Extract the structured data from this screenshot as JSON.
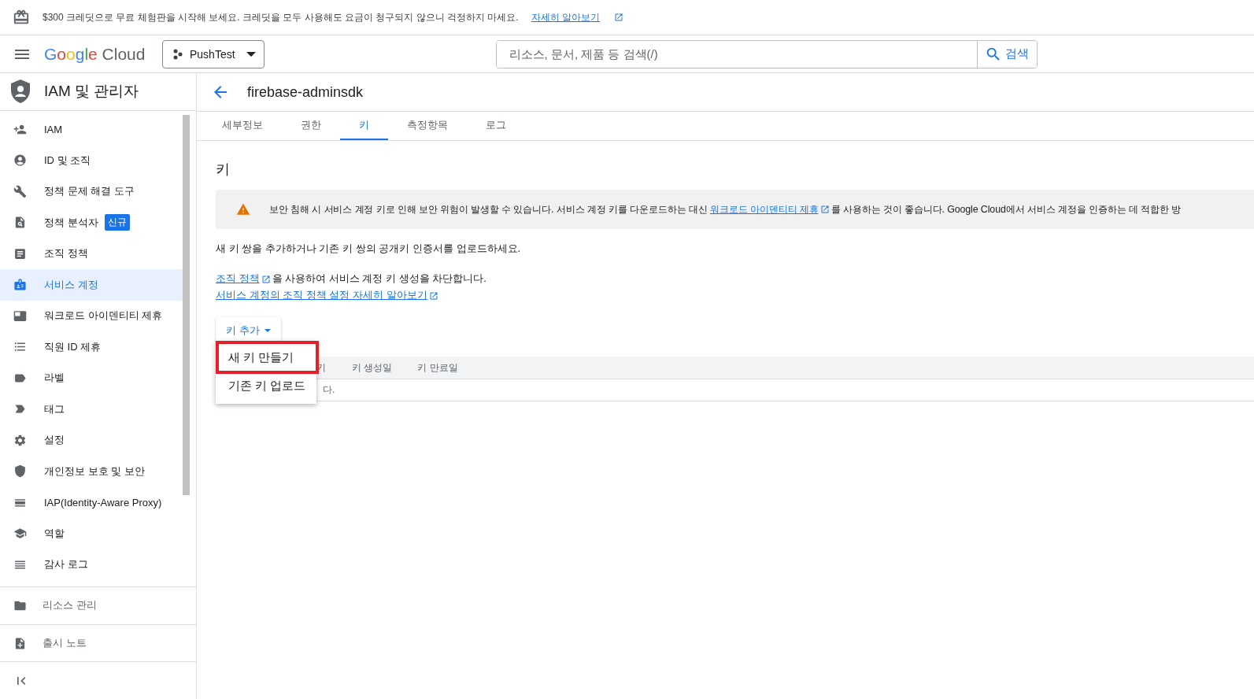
{
  "banner": {
    "text": "$300 크레딧으로 무료 체험판을 시작해 보세요. 크레딧을 모두 사용해도 요금이 청구되지 않으니 걱정하지 마세요.",
    "link": "자세히 알아보기"
  },
  "header": {
    "logo": {
      "brand": "Google",
      "product": "Cloud"
    },
    "project": "PushTest",
    "search": {
      "placeholder": "리소스, 문서, 제품 등 검색(/)",
      "button": "검색"
    }
  },
  "sidebar": {
    "title": "IAM 및 관리자",
    "items": [
      {
        "label": "IAM",
        "selected": false
      },
      {
        "label": "ID 및 조직",
        "selected": false
      },
      {
        "label": "정책 문제 해결 도구",
        "selected": false
      },
      {
        "label": "정책 분석자",
        "selected": false,
        "badge": "신규"
      },
      {
        "label": "조직 정책",
        "selected": false
      },
      {
        "label": "서비스 계정",
        "selected": true
      },
      {
        "label": "워크로드 아이덴티티 제휴",
        "selected": false
      },
      {
        "label": "직원 ID 제휴",
        "selected": false
      },
      {
        "label": "라벨",
        "selected": false
      },
      {
        "label": "태그",
        "selected": false
      },
      {
        "label": "설정",
        "selected": false
      },
      {
        "label": "개인정보 보호 및 보안",
        "selected": false
      },
      {
        "label": "IAP(Identity-Aware Proxy)",
        "selected": false
      },
      {
        "label": "역할",
        "selected": false
      },
      {
        "label": "감사 로그",
        "selected": false
      }
    ],
    "footer_items": [
      {
        "label": "리소스 관리"
      },
      {
        "label": "출시 노트"
      }
    ]
  },
  "page": {
    "title": "firebase-adminsdk",
    "tabs": [
      {
        "label": "세부정보",
        "selected": false
      },
      {
        "label": "권한",
        "selected": false
      },
      {
        "label": "키",
        "selected": true
      },
      {
        "label": "측정항목",
        "selected": false
      },
      {
        "label": "로그",
        "selected": false
      }
    ],
    "heading": "키",
    "warning": {
      "text_before": "보안 침해 시 서비스 계정 키로 인해 보안 위험이 발생할 수 있습니다. 서비스 계정 키를 다운로드하는 대신",
      "link": "워크로드 아이덴티티 제휴",
      "text_after": "를 사용하는 것이 좋습니다. Google Cloud에서 서비스 계정을 인증하는 데 적합한 방"
    },
    "intro": "새 키 쌍을 추가하거나 기존 키 쌍의 공개키 인증서를 업로드하세요.",
    "policy_link": "조직 정책",
    "policy_text": "을 사용하여 서비스 계정 키 생성을 차단합니다.",
    "learn_link": "서비스 계정의 조직 정책 설정 자세히 알아보기",
    "add_key_button": "키 추가",
    "menu": [
      {
        "label": "새 키 만들기",
        "selected": true
      },
      {
        "label": "기존 키 업로드",
        "selected": false
      }
    ],
    "table": {
      "columns": [
        "키",
        "키 생성일",
        "키 만료일"
      ],
      "empty_text": "다."
    }
  }
}
